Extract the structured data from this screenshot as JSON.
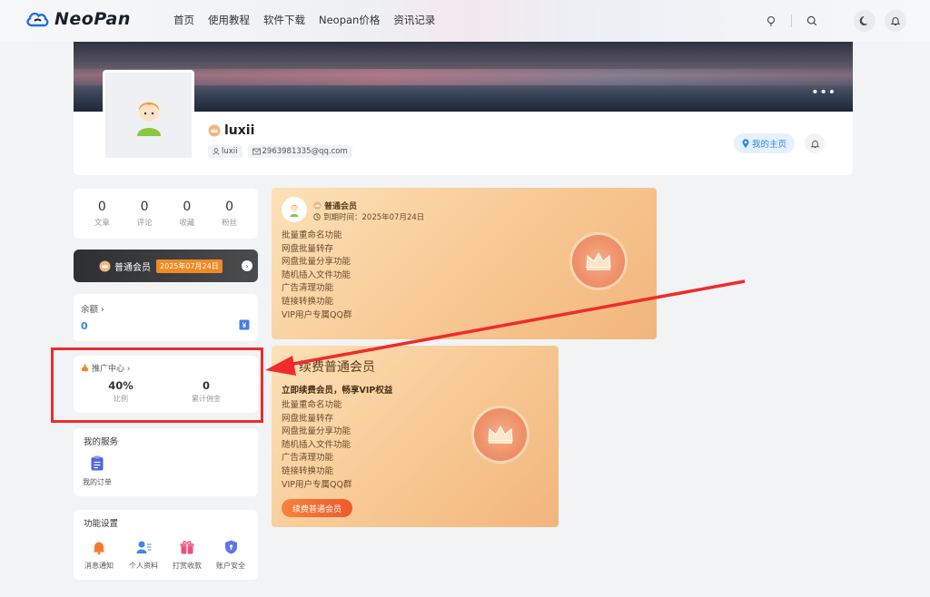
{
  "brand": {
    "name": "NeoPan"
  },
  "nav": [
    "首页",
    "使用教程",
    "软件下载",
    "Neopan价格",
    "资讯记录"
  ],
  "profile": {
    "username": "luxii",
    "login_name": "luxii",
    "email": "2963981335@qq.com",
    "homepage_label": "我的主页",
    "more": "•••"
  },
  "stats": [
    {
      "value": "0",
      "label": "文章"
    },
    {
      "value": "0",
      "label": "评论"
    },
    {
      "value": "0",
      "label": "收藏"
    },
    {
      "value": "0",
      "label": "粉丝"
    }
  ],
  "vip_bar": {
    "label": "普通会员",
    "date": "2025年07月24日"
  },
  "balance": {
    "title": "余额 ›",
    "value": "0"
  },
  "promo": {
    "title": "推广中心 ›",
    "ratio_value": "40%",
    "ratio_label": "比例",
    "commission_value": "0",
    "commission_label": "累计佣金"
  },
  "services": {
    "title": "我的服务",
    "items": [
      {
        "label": "我的订单",
        "icon": "clipboard-icon"
      }
    ]
  },
  "settings": {
    "title": "功能设置",
    "items": [
      {
        "label": "消息通知",
        "icon": "bell-icon"
      },
      {
        "label": "个人资料",
        "icon": "user-card-icon"
      },
      {
        "label": "打赏收款",
        "icon": "gift-icon"
      },
      {
        "label": "账户安全",
        "icon": "shield-icon"
      }
    ]
  },
  "card_current": {
    "level": "普通会员",
    "expire": "到期时间：2025年07月24日",
    "features": [
      "批量重命名功能",
      "网盘批量转存",
      "网盘批量分享功能",
      "随机插入文件功能",
      "广告清理功能",
      "链接转换功能",
      "VIP用户专属QQ群"
    ]
  },
  "card_renew": {
    "title": "续费普通会员",
    "subtitle": "立即续费会员，畅享VIP权益",
    "features": [
      "批量重命名功能",
      "网盘批量转存",
      "网盘批量分享功能",
      "随机插入文件功能",
      "广告清理功能",
      "链接转换功能",
      "VIP用户专属QQ群"
    ],
    "button": "续费普通会员"
  },
  "colors": {
    "accent": "#2e86e8",
    "annotation": "#ef2b2b",
    "vip_orange": "#f08a24"
  }
}
